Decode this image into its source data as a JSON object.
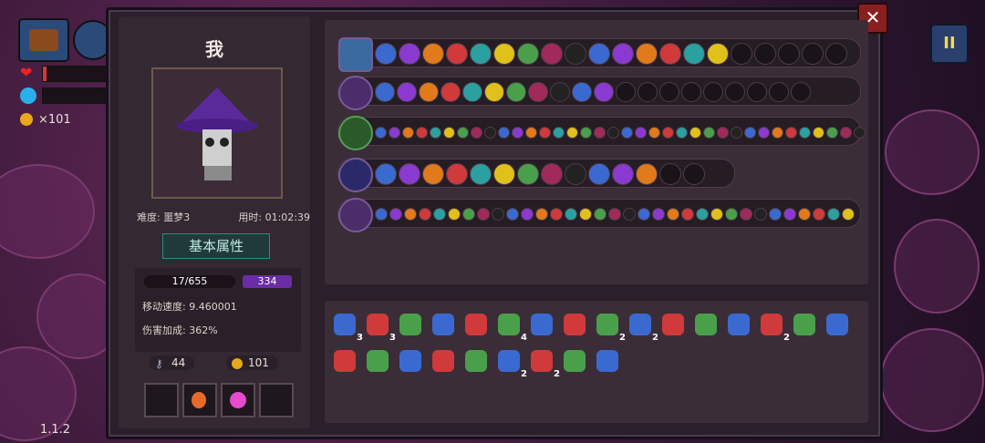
{
  "player": {
    "name": "我",
    "difficulty": "难度: 噩梦3",
    "time": "用时: 01:02:39",
    "version": "1.1.2"
  },
  "section_title": "基本属性",
  "stats": {
    "hp": "17/655",
    "mp": "334",
    "move_speed": "移动速度: 9.460001",
    "damage_bonus": "伤害加成: 362%"
  },
  "resources": {
    "keys": "44",
    "coins": "101",
    "hud_coins": "×101"
  },
  "close_label": "✕",
  "pause_label": "II",
  "inventory_counts": [
    "3",
    "3",
    "",
    "",
    "",
    "4",
    "",
    "",
    "2",
    "2",
    "",
    "",
    "",
    "2",
    "",
    "",
    "",
    "",
    "",
    "",
    "",
    "2",
    "2",
    "",
    ""
  ],
  "colors": {
    "accent_purple": "#6b2da6",
    "close_red": "#8a1f1f",
    "teal": "#2e8a80"
  }
}
